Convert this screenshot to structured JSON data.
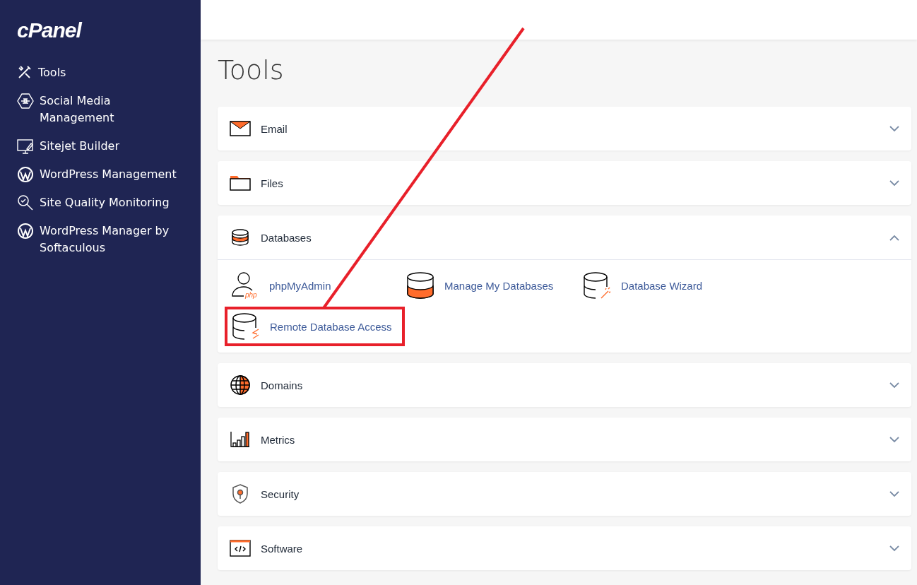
{
  "sidebar": {
    "logo": "cPanel",
    "items": [
      {
        "label": "Tools"
      },
      {
        "label": "Social Media Management"
      },
      {
        "label": "Sitejet Builder"
      },
      {
        "label": "WordPress Management"
      },
      {
        "label": "Site Quality Monitoring"
      },
      {
        "label": "WordPress Manager by Softaculous"
      }
    ]
  },
  "page_title": "Tools",
  "sections": [
    {
      "label": "Email",
      "expanded": false
    },
    {
      "label": "Files",
      "expanded": false
    },
    {
      "label": "Databases",
      "expanded": true,
      "items": [
        {
          "label": "phpMyAdmin",
          "highlighted": false,
          "icon_text": "php"
        },
        {
          "label": "Manage My Databases",
          "highlighted": false
        },
        {
          "label": "Database Wizard",
          "highlighted": false
        },
        {
          "label": "Remote Database Access",
          "highlighted": true
        }
      ]
    },
    {
      "label": "Domains",
      "expanded": false
    },
    {
      "label": "Metrics",
      "expanded": false
    },
    {
      "label": "Security",
      "expanded": false
    },
    {
      "label": "Software",
      "expanded": false
    }
  ]
}
